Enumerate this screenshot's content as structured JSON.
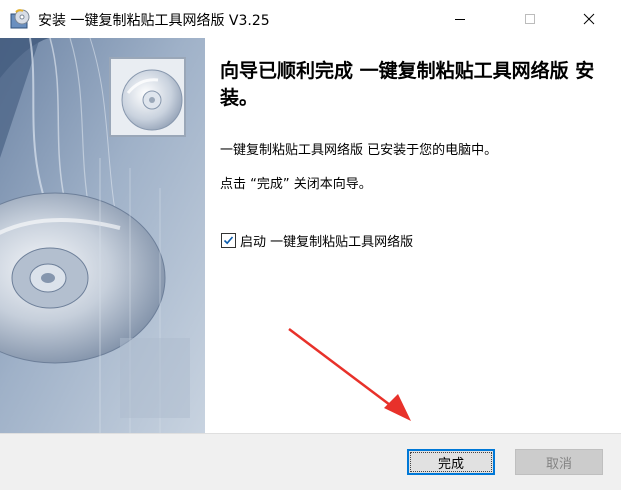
{
  "window": {
    "title": "安装 一键复制粘贴工具网络版 V3.25",
    "app_icon": "installer-cd-icon",
    "controls": [
      "minimize-icon",
      "maximize-icon",
      "close-icon"
    ]
  },
  "banner": {
    "image": "cd-disc-artwork",
    "colors": {
      "dark": "#3e5678",
      "light": "#bcc9d9"
    }
  },
  "content": {
    "heading": "向导已顺利完成 一键复制粘贴工具网络版 安装。",
    "description_line1": "一键复制粘贴工具网络版 已安装于您的电脑中。",
    "description_line2": "点击 “完成” 关闭本向导。",
    "launch_checkbox": {
      "label": "启动 一键复制粘贴工具网络版",
      "checked": true
    }
  },
  "buttons": {
    "finish_label": "完成",
    "cancel_label": "取消"
  },
  "annotation": {
    "type": "red-arrow",
    "color": "#e8312a"
  }
}
